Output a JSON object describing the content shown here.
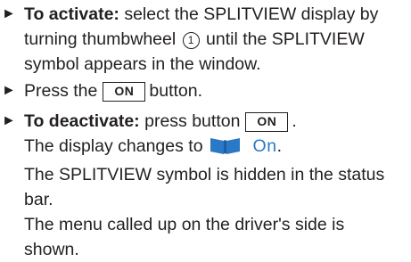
{
  "step1": {
    "bullet": "►",
    "bold": "To activate:",
    "text_a": " select the SPLITVIEW display by",
    "line2": "turning thumbwheel",
    "circled_number": "1",
    "line2_end": " until the SPLITVIEW",
    "line3": "symbol appears in the window."
  },
  "step2": {
    "bullet": "►",
    "text": "Press the",
    "button_label": "ON",
    "text_end": "button."
  },
  "step3": {
    "bullet": "►",
    "bold": "To deactivate:",
    "text": " press button",
    "button_label": "ON",
    "text_end": ".",
    "line2": "The display changes to",
    "display_text": "On",
    "line2_end": ".",
    "line3": "The SPLITVIEW symbol is hidden in the status",
    "line4": "bar.",
    "line5": "The menu called up on the driver's side is",
    "line6": "shown."
  },
  "colors": {
    "text": "#231f20",
    "display_text": "#2a78c6",
    "icon": "#2a78c6"
  },
  "icons": {
    "bullet": "triangle-right",
    "split_view": "splitview-book-icon"
  }
}
